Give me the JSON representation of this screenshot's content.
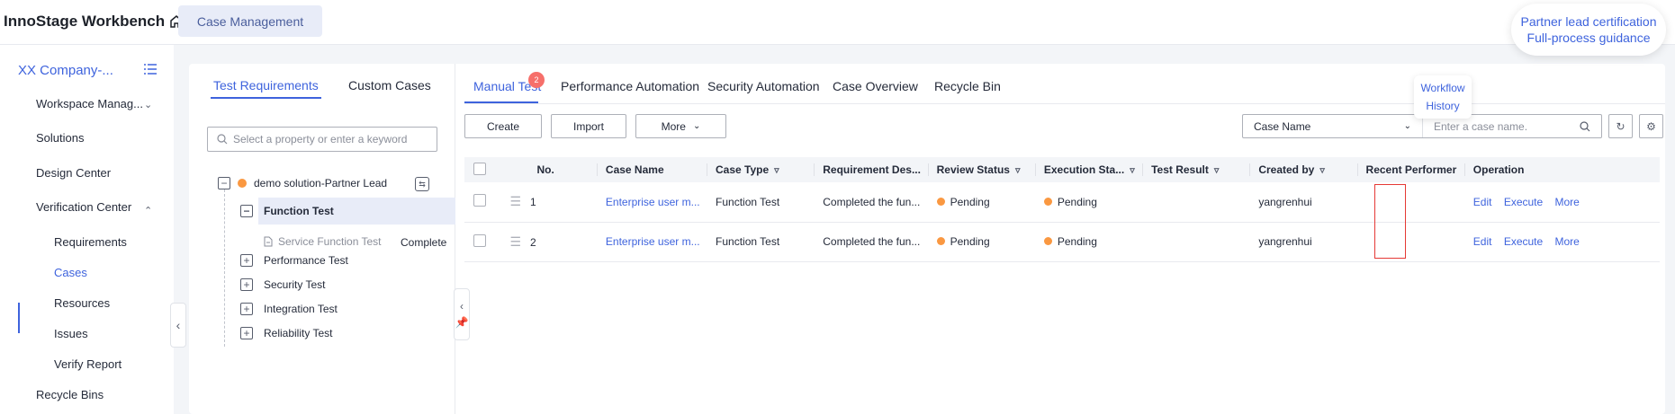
{
  "app": {
    "title": "InnoStage Workbench"
  },
  "top_tab": "Case Management",
  "guide": {
    "line1": "Partner lead certification",
    "line2": "Full-process guidance"
  },
  "sidebar": {
    "company": "XX Company-...",
    "items": [
      {
        "label": "Workspace Manag...",
        "chevron": "down"
      },
      {
        "label": "Solutions"
      },
      {
        "label": "Design Center"
      },
      {
        "label": "Verification Center",
        "chevron": "up"
      },
      {
        "label": "Requirements",
        "sub": true
      },
      {
        "label": "Cases",
        "sub": true,
        "active": true
      },
      {
        "label": "Resources",
        "sub": true
      },
      {
        "label": "Issues",
        "sub": true
      },
      {
        "label": "Verify Report",
        "sub": true
      },
      {
        "label": "Recycle Bins"
      }
    ]
  },
  "left_panel": {
    "tabs": [
      "Test Requirements",
      "Custom Cases"
    ],
    "active_tab": "Test Requirements",
    "search_placeholder": "Select a property or enter a keyword",
    "tree": {
      "root": "demo solution-Partner Lead",
      "nodes": [
        "Function Test",
        "Performance Test",
        "Security Test",
        "Integration Test",
        "Reliability Test"
      ],
      "leaf": {
        "label": "Service Function Test",
        "status": "Complete"
      }
    }
  },
  "main_tabs": {
    "items": [
      "Manual Test",
      "Performance Automation",
      "Security Automation",
      "Case Overview",
      "Recycle Bin"
    ],
    "active": "Manual Test",
    "badge": "2"
  },
  "float_card": {
    "line1": "Workflow",
    "line2": "History"
  },
  "toolbar": {
    "create": "Create",
    "import": "Import",
    "more": "More",
    "filter_field": "Case Name",
    "filter_placeholder": "Enter a case name."
  },
  "table": {
    "columns": [
      "No.",
      "Case Name",
      "Case Type",
      "Requirement Des...",
      "Review Status",
      "Execution Sta...",
      "Test Result",
      "Created by",
      "Recent Performer",
      "Operation"
    ],
    "rows": [
      {
        "no": "1",
        "name": "Enterprise user m...",
        "type": "Function Test",
        "req": "Completed the fun...",
        "review": "Pending",
        "exec": "Pending",
        "result": "",
        "created_by": "yangrenhui",
        "performer": "",
        "ops": [
          "Edit",
          "Execute",
          "More"
        ]
      },
      {
        "no": "2",
        "name": "Enterprise user m...",
        "type": "Function Test",
        "req": "Completed the fun...",
        "review": "Pending",
        "exec": "Pending",
        "result": "",
        "created_by": "yangrenhui",
        "performer": "",
        "ops": [
          "Edit",
          "Execute",
          "More"
        ]
      }
    ]
  },
  "colors": {
    "accent": "#3e63dd",
    "pending": "#fa9841",
    "badge": "#f66f6a",
    "highlight": "#e53935"
  }
}
